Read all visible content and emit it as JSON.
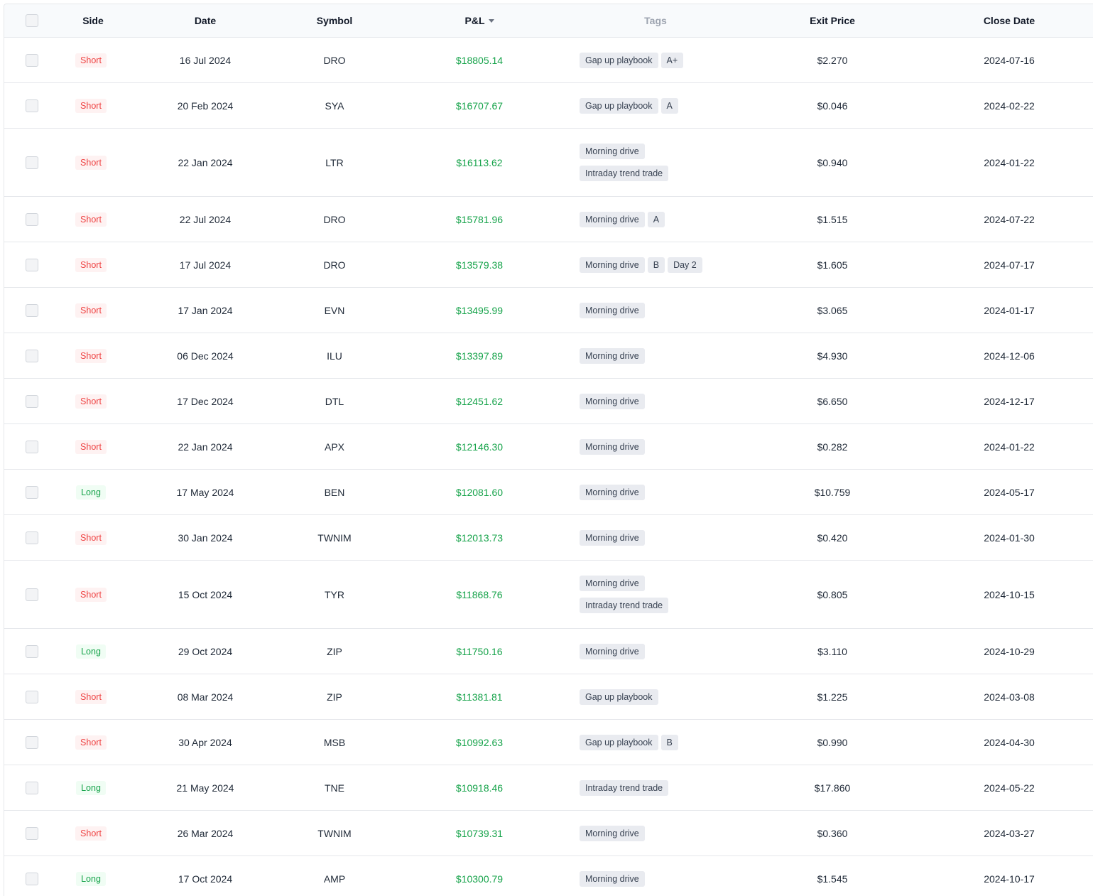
{
  "colors": {
    "short_text": "#ef4444",
    "short_bg": "#fef2f2",
    "long_text": "#16a34a",
    "long_bg": "#f0fdf4",
    "pnl_positive": "#16a34a",
    "tag_bg": "#e9ebf0",
    "header_bg": "#f8fafc"
  },
  "header": {
    "side": "Side",
    "date": "Date",
    "symbol": "Symbol",
    "pnl": "P&L",
    "pnl_sort_icon": "caret-down-icon",
    "tags": "Tags",
    "exit_price": "Exit Price",
    "close_date": "Close Date"
  },
  "rows": [
    {
      "side": "Short",
      "date": "16 Jul 2024",
      "symbol": "DRO",
      "pnl": "$18805.14",
      "tags": [
        [
          "Gap up playbook",
          "A+"
        ]
      ],
      "exit_price": "$2.270",
      "close_date": "2024-07-16"
    },
    {
      "side": "Short",
      "date": "20 Feb 2024",
      "symbol": "SYA",
      "pnl": "$16707.67",
      "tags": [
        [
          "Gap up playbook",
          "A"
        ]
      ],
      "exit_price": "$0.046",
      "close_date": "2024-02-22"
    },
    {
      "side": "Short",
      "date": "22 Jan 2024",
      "symbol": "LTR",
      "pnl": "$16113.62",
      "tags": [
        [
          "Morning drive"
        ],
        [
          "Intraday trend trade"
        ]
      ],
      "exit_price": "$0.940",
      "close_date": "2024-01-22"
    },
    {
      "side": "Short",
      "date": "22 Jul 2024",
      "symbol": "DRO",
      "pnl": "$15781.96",
      "tags": [
        [
          "Morning drive",
          "A"
        ]
      ],
      "exit_price": "$1.515",
      "close_date": "2024-07-22"
    },
    {
      "side": "Short",
      "date": "17 Jul 2024",
      "symbol": "DRO",
      "pnl": "$13579.38",
      "tags": [
        [
          "Morning drive",
          "B",
          "Day 2"
        ]
      ],
      "exit_price": "$1.605",
      "close_date": "2024-07-17"
    },
    {
      "side": "Short",
      "date": "17 Jan 2024",
      "symbol": "EVN",
      "pnl": "$13495.99",
      "tags": [
        [
          "Morning drive"
        ]
      ],
      "exit_price": "$3.065",
      "close_date": "2024-01-17"
    },
    {
      "side": "Short",
      "date": "06 Dec 2024",
      "symbol": "ILU",
      "pnl": "$13397.89",
      "tags": [
        [
          "Morning drive"
        ]
      ],
      "exit_price": "$4.930",
      "close_date": "2024-12-06"
    },
    {
      "side": "Short",
      "date": "17 Dec 2024",
      "symbol": "DTL",
      "pnl": "$12451.62",
      "tags": [
        [
          "Morning drive"
        ]
      ],
      "exit_price": "$6.650",
      "close_date": "2024-12-17"
    },
    {
      "side": "Short",
      "date": "22 Jan 2024",
      "symbol": "APX",
      "pnl": "$12146.30",
      "tags": [
        [
          "Morning drive"
        ]
      ],
      "exit_price": "$0.282",
      "close_date": "2024-01-22"
    },
    {
      "side": "Long",
      "date": "17 May 2024",
      "symbol": "BEN",
      "pnl": "$12081.60",
      "tags": [
        [
          "Morning drive"
        ]
      ],
      "exit_price": "$10.759",
      "close_date": "2024-05-17"
    },
    {
      "side": "Short",
      "date": "30 Jan 2024",
      "symbol": "TWNIM",
      "pnl": "$12013.73",
      "tags": [
        [
          "Morning drive"
        ]
      ],
      "exit_price": "$0.420",
      "close_date": "2024-01-30"
    },
    {
      "side": "Short",
      "date": "15 Oct 2024",
      "symbol": "TYR",
      "pnl": "$11868.76",
      "tags": [
        [
          "Morning drive"
        ],
        [
          "Intraday trend trade"
        ]
      ],
      "exit_price": "$0.805",
      "close_date": "2024-10-15"
    },
    {
      "side": "Long",
      "date": "29 Oct 2024",
      "symbol": "ZIP",
      "pnl": "$11750.16",
      "tags": [
        [
          "Morning drive"
        ]
      ],
      "exit_price": "$3.110",
      "close_date": "2024-10-29"
    },
    {
      "side": "Short",
      "date": "08 Mar 2024",
      "symbol": "ZIP",
      "pnl": "$11381.81",
      "tags": [
        [
          "Gap up playbook"
        ]
      ],
      "exit_price": "$1.225",
      "close_date": "2024-03-08"
    },
    {
      "side": "Short",
      "date": "30 Apr 2024",
      "symbol": "MSB",
      "pnl": "$10992.63",
      "tags": [
        [
          "Gap up playbook",
          "B"
        ]
      ],
      "exit_price": "$0.990",
      "close_date": "2024-04-30"
    },
    {
      "side": "Long",
      "date": "21 May 2024",
      "symbol": "TNE",
      "pnl": "$10918.46",
      "tags": [
        [
          "Intraday trend trade"
        ]
      ],
      "exit_price": "$17.860",
      "close_date": "2024-05-22"
    },
    {
      "side": "Short",
      "date": "26 Mar 2024",
      "symbol": "TWNIM",
      "pnl": "$10739.31",
      "tags": [
        [
          "Morning drive"
        ]
      ],
      "exit_price": "$0.360",
      "close_date": "2024-03-27"
    },
    {
      "side": "Long",
      "date": "17 Oct 2024",
      "symbol": "AMP",
      "pnl": "$10300.79",
      "tags": [
        [
          "Morning drive"
        ]
      ],
      "exit_price": "$1.545",
      "close_date": "2024-10-17"
    }
  ]
}
